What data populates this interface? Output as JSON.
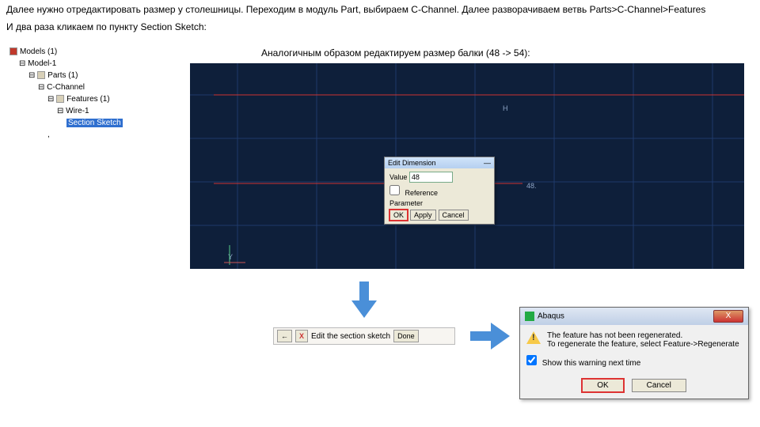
{
  "instructions": {
    "line1": "Далее нужно отредактировать размер у столешницы. Переходим в модуль Part, выбираем C-Channel. Далее разворачиваем ветвь Parts>C-Channel>Features",
    "line2": "И два раза кликаем по пункту Section Sketch:"
  },
  "caption": "Аналогичным образом редактируем размер балки (48 -> 54):",
  "tree": {
    "root": "Models (1)",
    "model": "Model-1",
    "parts": "Parts (1)",
    "cchannel": "C-Channel",
    "features": "Features (1)",
    "wire": "Wire-1",
    "section": "Section Sketch"
  },
  "sketch": {
    "hmark": "H",
    "ymark": "Y",
    "dimlabel": "48."
  },
  "edit_dialog": {
    "title": "Edit Dimension",
    "xtitle": "—",
    "value_label": "Value",
    "value": "48",
    "reference_label": "Reference",
    "parameter_label": "Parameter",
    "ok": "OK",
    "apply": "Apply",
    "cancel": "Cancel"
  },
  "prompt": {
    "back_icon": "←",
    "x_icon": "X",
    "text": "Edit the section sketch",
    "done": "Done"
  },
  "warning": {
    "app": "Abaqus",
    "msg1": "The feature has not been regenerated.",
    "msg2": "To regenerate the feature, select Feature->Regenerate",
    "check": "Show this warning next time",
    "ok": "OK",
    "cancel": "Cancel",
    "close": "X"
  }
}
